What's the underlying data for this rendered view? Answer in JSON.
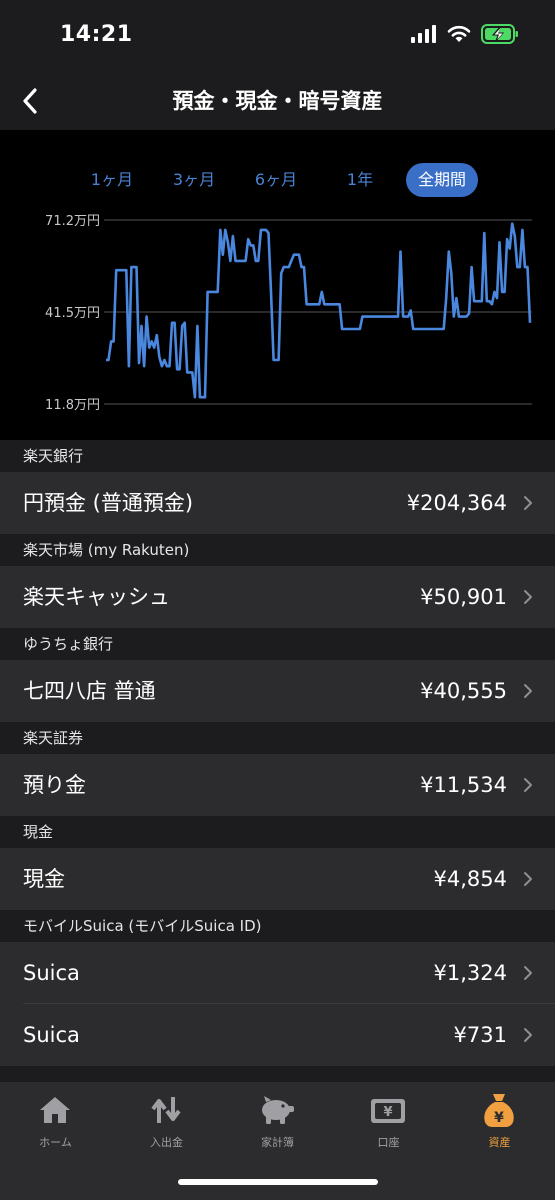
{
  "status": {
    "time": "14:21"
  },
  "nav": {
    "title": "預金・現金・暗号資産"
  },
  "range_tabs": [
    "1ヶ月",
    "3ヶ月",
    "6ヶ月",
    "1年",
    "全期間"
  ],
  "range_selected": "全期間",
  "chart_data": {
    "type": "line",
    "y_unit": "万円",
    "ylim": [
      11.8,
      71.2
    ],
    "y_ticks": [
      "71.2万円",
      "41.5万円",
      "11.8万円"
    ],
    "grid": true,
    "color": "#4a88e0",
    "values": [
      26,
      26,
      32,
      32,
      55,
      55,
      55,
      55,
      55,
      24,
      56,
      56,
      56,
      25,
      37,
      24,
      40,
      30,
      32,
      30,
      34,
      27,
      24,
      26,
      24,
      24,
      38,
      38,
      23,
      23,
      37,
      38,
      22,
      22,
      22,
      14,
      37,
      14,
      14,
      14,
      48,
      48,
      48,
      48,
      48,
      68,
      60,
      68,
      64,
      58,
      66,
      58,
      58,
      58,
      58,
      58,
      65,
      63,
      63,
      58,
      58,
      68,
      68,
      68,
      67,
      48,
      26,
      26,
      26,
      54,
      56,
      56,
      56,
      58,
      60,
      60,
      60,
      56,
      56,
      44,
      44,
      44,
      44,
      44,
      44,
      48,
      44,
      44,
      44,
      44,
      44,
      44,
      44,
      36,
      36,
      36,
      36,
      36,
      36,
      36,
      36,
      40,
      40,
      40,
      40,
      40,
      40,
      40,
      40,
      40,
      40,
      40,
      40,
      40,
      40,
      40,
      61,
      40,
      40,
      40,
      42,
      36,
      36,
      36,
      36,
      36,
      36,
      36,
      36,
      36,
      36,
      36,
      36,
      36,
      46,
      61,
      54,
      40,
      46,
      40,
      40,
      40,
      40,
      41,
      56,
      45,
      45,
      45,
      45,
      67,
      45,
      45,
      44,
      48,
      46,
      64,
      48,
      48,
      65,
      62,
      70,
      66,
      56,
      56,
      68,
      56,
      56,
      38
    ]
  },
  "sections": [
    {
      "header": "楽天銀行",
      "rows": [
        {
          "label": "円預金 (普通預金)",
          "value": "¥204,364"
        }
      ]
    },
    {
      "header": "楽天市場 (my Rakuten)",
      "rows": [
        {
          "label": "楽天キャッシュ",
          "value": "¥50,901"
        }
      ]
    },
    {
      "header": "ゆうちょ銀行",
      "rows": [
        {
          "label": "七四八店 普通",
          "value": "¥40,555"
        }
      ]
    },
    {
      "header": "楽天証券",
      "rows": [
        {
          "label": "預り金",
          "value": "¥11,534"
        }
      ]
    },
    {
      "header": "現金",
      "rows": [
        {
          "label": "現金",
          "value": "¥4,854"
        }
      ]
    },
    {
      "header": "モバイルSuica (モバイルSuica ID)",
      "rows": [
        {
          "label": "Suica",
          "value": "¥1,324"
        },
        {
          "label": "Suica",
          "value": "¥731"
        }
      ]
    }
  ],
  "tab_bar": {
    "items": [
      {
        "label": "ホーム",
        "icon": "home-icon"
      },
      {
        "label": "入出金",
        "icon": "transfer-icon"
      },
      {
        "label": "家計簿",
        "icon": "piggy-bank-icon"
      },
      {
        "label": "口座",
        "icon": "wallet-icon"
      },
      {
        "label": "資産",
        "icon": "money-bag-icon"
      }
    ],
    "active": "資産",
    "active_color": "#f0a040"
  }
}
